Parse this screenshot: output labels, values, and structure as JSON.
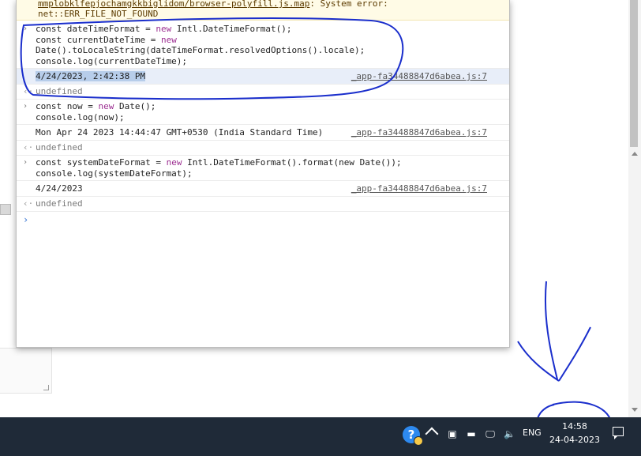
{
  "console": {
    "error": {
      "line1_link": "mmplobklfepjochamgkkbiglidom/browser-polyfill.js.map",
      "line1_rest": ": System error:",
      "line2": "net::ERR_FILE_NOT_FOUND"
    },
    "entries": [
      {
        "code": [
          [
            "const dateTimeFormat = ",
            "new",
            " Intl.DateTimeFormat();"
          ],
          [
            "const currentDateTime = ",
            "new",
            ""
          ],
          [
            "Date().toLocaleString(dateTimeFormat.resolvedOptions().locale);",
            "",
            ""
          ],
          [
            "console.log(currentDateTime);",
            "",
            ""
          ]
        ],
        "output": "4/24/2023, 2:42:38 PM",
        "source": "_app-fa34488847d6abea.js:7",
        "return": "undefined"
      },
      {
        "code": [
          [
            "const now = ",
            "new",
            " Date();"
          ],
          [
            "console.log(now);",
            "",
            ""
          ]
        ],
        "output": "Mon Apr 24 2023 14:44:47 GMT+0530 (India Standard Time)",
        "source": "_app-fa34488847d6abea.js:7",
        "return": "undefined"
      },
      {
        "code": [
          [
            "const systemDateFormat = ",
            "new",
            " Intl.DateTimeFormat().format(new Date());"
          ],
          [
            "console.log(systemDateFormat);",
            "",
            ""
          ]
        ],
        "output": "4/24/2023",
        "source": "_app-fa34488847d6abea.js:7",
        "return": "undefined"
      }
    ]
  },
  "taskbar": {
    "language": "ENG",
    "time": "14:58",
    "date": "24-04-2023",
    "icons": [
      "help-icon",
      "chevron-up-icon",
      "meet-now-icon",
      "battery-icon",
      "network-icon",
      "volume-icon",
      "notification-icon"
    ],
    "annotation_color": "#1a2ecc"
  }
}
